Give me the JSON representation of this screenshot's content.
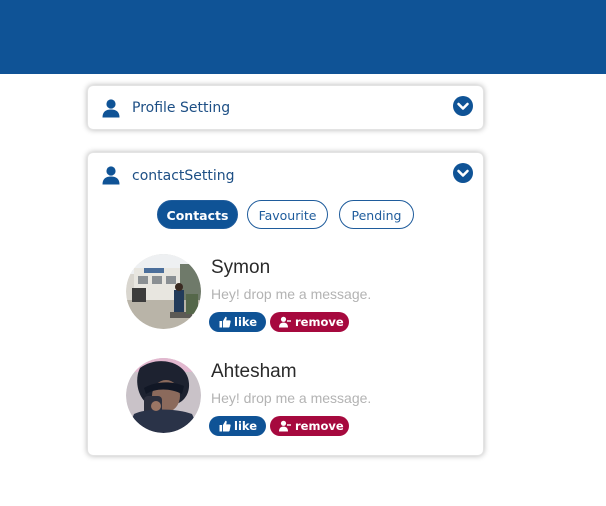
{
  "colors": {
    "topbar": "#0f5396",
    "primary": "#0f5396",
    "danger": "#a6093e",
    "title_text": "#1d4f85",
    "muted_text": "#b3b3b3"
  },
  "profile_section": {
    "title": "Profile Setting",
    "icon": "user-icon",
    "toggle_icon": "chevron-down-circle-icon"
  },
  "contact_section": {
    "title": "contactSetting",
    "icon": "user-icon",
    "toggle_icon": "chevron-down-circle-icon",
    "tabs": [
      {
        "label": "Contacts",
        "active": true
      },
      {
        "label": "Favourite",
        "active": false
      },
      {
        "label": "Pending",
        "active": false
      }
    ],
    "contacts": [
      {
        "name": "Symon",
        "message": "Hey! drop me a message.",
        "like_label": "like",
        "remove_label": "remove",
        "avatar": "photo-building-avatar"
      },
      {
        "name": "Ahtesham",
        "message": "Hey! drop me a message.",
        "like_label": "like",
        "remove_label": "remove",
        "avatar": "photo-person-avatar"
      }
    ]
  }
}
